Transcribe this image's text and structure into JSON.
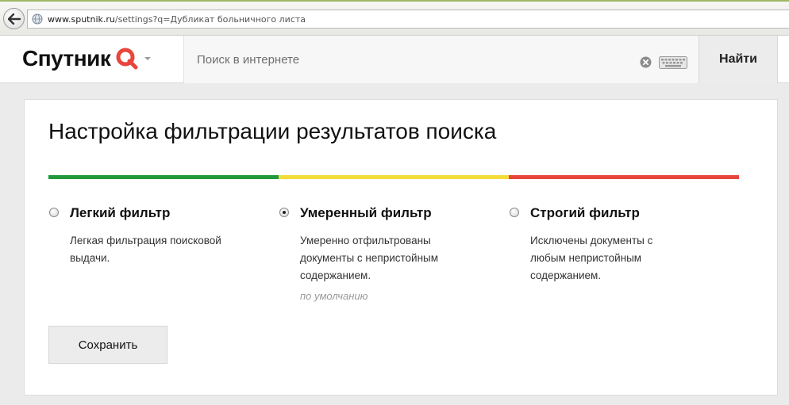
{
  "browser": {
    "url_host": "www.sputnik.ru",
    "url_rest": "/settings?q=Дубликат больничного листа"
  },
  "header": {
    "logo_text": "Спутник",
    "search_placeholder": "Поиск в интернете",
    "search_value": "",
    "find_label": "Найти"
  },
  "settings": {
    "title": "Настройка фильтрации результатов поиска",
    "severity_colors": [
      "#229a3b",
      "#f2dc3c",
      "#e8453c"
    ],
    "options": [
      {
        "title": "Легкий фильтр",
        "description": "Легкая фильтрация поисковой выдачи.",
        "checked": false
      },
      {
        "title": "Умеренный фильтр",
        "description": "Умеренно отфильтрованы документы с непристойным содержанием.",
        "checked": true,
        "note": "по умолчанию"
      },
      {
        "title": "Строгий фильтр",
        "description": "Исключены документы с любым непристойным содержанием.",
        "checked": false
      }
    ],
    "save_label": "Сохранить"
  },
  "colors": {
    "accent_red": "#e8453c",
    "page_bg": "#ebebeb"
  },
  "icons": [
    "back-arrow-icon",
    "globe-icon",
    "sputnik-logo-icon",
    "chevron-down-icon",
    "clear-icon",
    "keyboard-icon"
  ]
}
